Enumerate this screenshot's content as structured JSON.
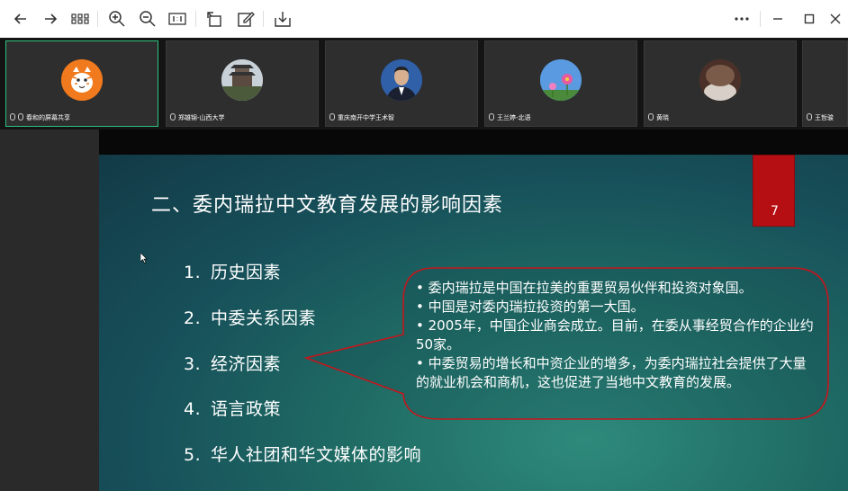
{
  "toolbar": {
    "icons": [
      "back-arrow-icon",
      "forward-arrow-icon",
      "grid-icon",
      "zoom-in-icon",
      "zoom-out-icon",
      "actual-size-icon",
      "rotate-icon",
      "edit-icon",
      "download-icon",
      "more-icon",
      "minimize-icon",
      "maximize-icon",
      "close-icon"
    ]
  },
  "participants": [
    {
      "name": "春和的屏幕共享",
      "avatar": "tiger-icon",
      "active": true
    },
    {
      "name": "郑雄锦-山西大学",
      "avatar": "building-photo-icon",
      "active": false
    },
    {
      "name": "重庆南开中学王术智",
      "avatar": "man-suit-photo-icon",
      "active": false
    },
    {
      "name": "王兰婷-北语",
      "avatar": "flower-photo-icon",
      "active": false
    },
    {
      "name": "黄晓",
      "avatar": "dark-photo-icon",
      "active": false
    },
    {
      "name": "王哲骏",
      "avatar": "",
      "active": false
    }
  ],
  "slide": {
    "title": "二、委内瑞拉中文教育发展的影响因素",
    "page_number": "7",
    "list": [
      {
        "num": "1.",
        "text": "历史因素"
      },
      {
        "num": "2.",
        "text": "中委关系因素"
      },
      {
        "num": "3.",
        "text": "经济因素"
      },
      {
        "num": "4.",
        "text": "语言政策"
      },
      {
        "num": "5.",
        "text": "华人社团和华文媒体的影响"
      }
    ],
    "callout": [
      "• 委内瑞拉是中国在拉美的重要贸易伙伴和投资对象国。",
      "• 中国是对委内瑞拉投资的第一大国。",
      "• 2005年，中国企业商会成立。目前，在委从事经贸合作的企业约50家。",
      "• 中委贸易的增长和中资企业的增多，为委内瑞拉社会提供了大量的就业机会和商机，这也促进了当地中文教育的发展。"
    ]
  },
  "colors": {
    "accent_green": "#2ec27e",
    "page_tab_red": "#b50f13",
    "callout_border": "#c4161c"
  }
}
